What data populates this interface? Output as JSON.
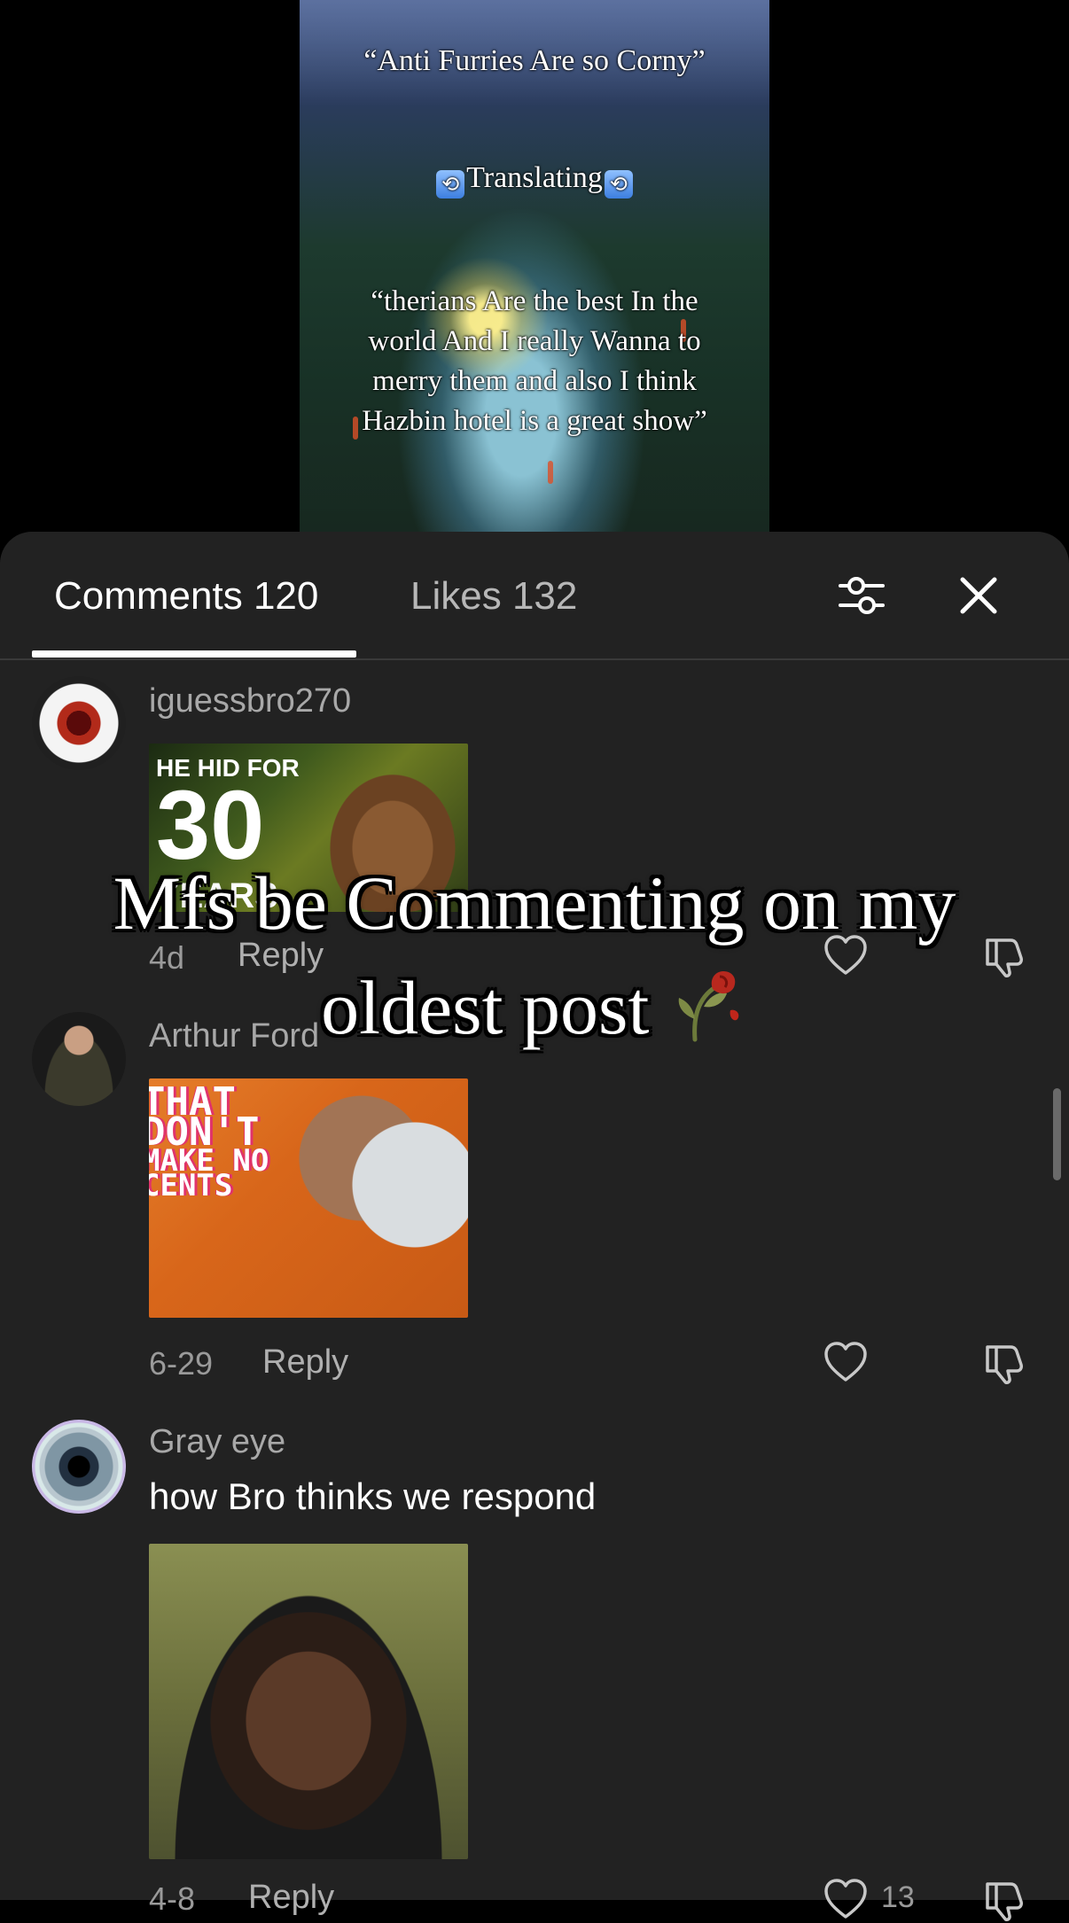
{
  "video": {
    "overlay_line_1": "“Anti Furries Are so Corny”",
    "overlay_line_2_text": "Translating",
    "overlay_line_3": "“therians Are the best In the world And I really Wanna to merry them and also I think Hazbin hotel is a great show”"
  },
  "meme_caption": {
    "line_1": "Mfs be Commenting on my",
    "line_2": "oldest post"
  },
  "tabs": {
    "comments_label": "Comments 120",
    "likes_label": "Likes 132",
    "active": "comments"
  },
  "icons": {
    "filter": "sliders-icon",
    "close": "close-icon",
    "like": "heart-icon",
    "dislike": "thumbs-down-icon",
    "translate": "swap-arrows-icon",
    "emoji": "wilted-rose-emoji"
  },
  "colors": {
    "sheet_bg": "#222222",
    "text_primary": "#ffffff",
    "text_secondary": "#a8a8a8"
  },
  "comments": [
    {
      "username": "iguessbro270",
      "thumbnail_text_1": "HE HID FOR",
      "thumbnail_text_2": "30",
      "thumbnail_text_3": "YEARS",
      "time": "4d",
      "reply_label": "Reply"
    },
    {
      "username": "Arthur Ford",
      "thumbnail_text": [
        "THAT",
        "DON'T",
        "MAKE NO",
        "CENTS"
      ],
      "time": "6-29",
      "reply_label": "Reply"
    },
    {
      "username": "Gray eye",
      "text": "how Bro thinks we respond",
      "time": "4-8",
      "reply_label": "Reply",
      "likes": "13"
    }
  ]
}
